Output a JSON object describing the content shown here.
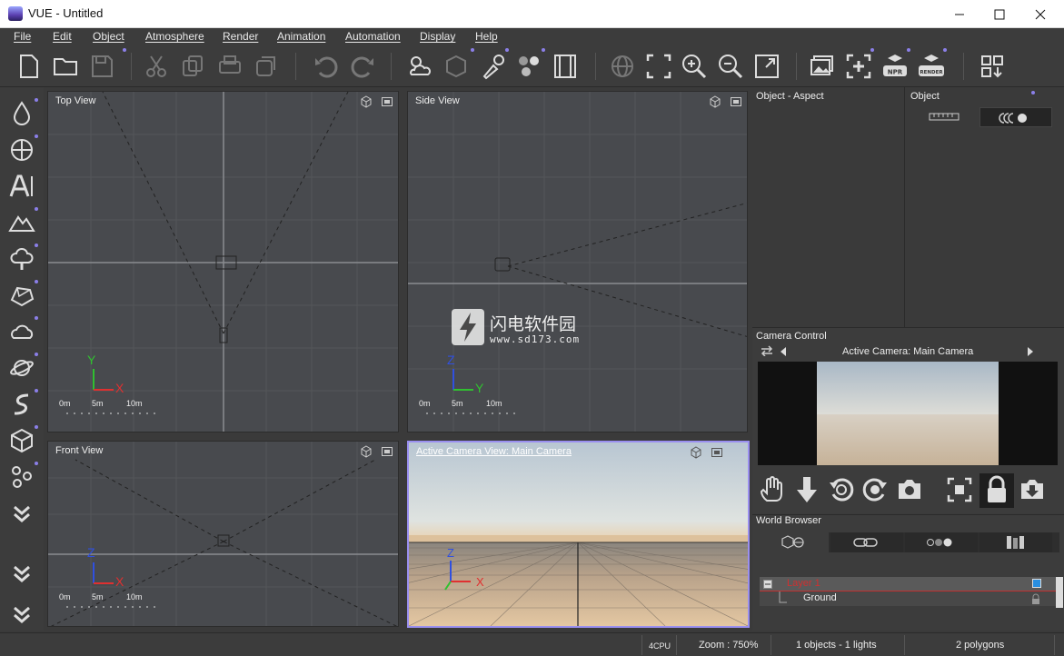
{
  "window": {
    "title": "VUE - Untitled"
  },
  "menu": [
    "File",
    "Edit",
    "Object",
    "Atmosphere",
    "Render",
    "Animation",
    "Automation",
    "Display",
    "Help"
  ],
  "toolbar_icons": [
    "new-file-icon",
    "open-folder-icon",
    "save-icon",
    "cut-icon",
    "copy-icon",
    "paste-icon",
    "duplicate-icon",
    "undo-icon",
    "redo-icon",
    "atmosphere-editor-icon",
    "object-editor-icon",
    "paint-brush-icon",
    "material-spheres-icon",
    "film-strip-icon",
    "globe-icon",
    "frame-icon",
    "zoom-in-icon",
    "zoom-out-icon",
    "maximize-icon",
    "gallery-icon",
    "add-object-icon",
    "npr-render-icon",
    "render-icon",
    "layout-icon"
  ],
  "toolbar_badges": {
    "npr": "NPR",
    "render": "RENDER"
  },
  "left_toolbar_icons": [
    "water-icon",
    "sphere-icon",
    "text-icon",
    "terrain-icon",
    "tree-icon",
    "rock-icon",
    "cloud-icon",
    "planet-icon",
    "spline-icon",
    "cube-icon",
    "molecule-icon",
    "expand-down-icon",
    "expand-down-icon-2",
    "expand-down-icon-3"
  ],
  "views": {
    "top": {
      "title": "Top View",
      "axis1": "Y",
      "axis2": "X",
      "scale": [
        "0m",
        "5m",
        "10m"
      ]
    },
    "side": {
      "title": "Side View",
      "axis1": "Z",
      "axis2": "Y",
      "scale": [
        "0m",
        "5m",
        "10m"
      ]
    },
    "front": {
      "title": "Front View",
      "axis1": "Z",
      "axis2": "X",
      "scale": [
        "0m",
        "5m",
        "10m"
      ]
    },
    "camera": {
      "title": "Active Camera View: Main Camera",
      "axis1": "Z",
      "axis2": "X"
    }
  },
  "panels": {
    "aspect_title": "Object - Aspect",
    "object_title": "Object",
    "camera_control_title": "Camera Control",
    "active_camera": "Active Camera: Main Camera",
    "world_browser_title": "World Browser",
    "layer_name": "Layer 1",
    "ground_name": "Ground"
  },
  "watermark": {
    "brand": "闪电软件园",
    "url": "www.sd173.com"
  },
  "status": {
    "cpu": "4CPU",
    "zoom": "Zoom : 750%",
    "objects": "1 objects - 1 lights",
    "polygons": "2 polygons"
  },
  "colors": {
    "accent": "#8b7fe8",
    "x_axis": "#e03030",
    "y_axis": "#30c030",
    "z_axis": "#3050e0",
    "layer": "#c03030"
  }
}
